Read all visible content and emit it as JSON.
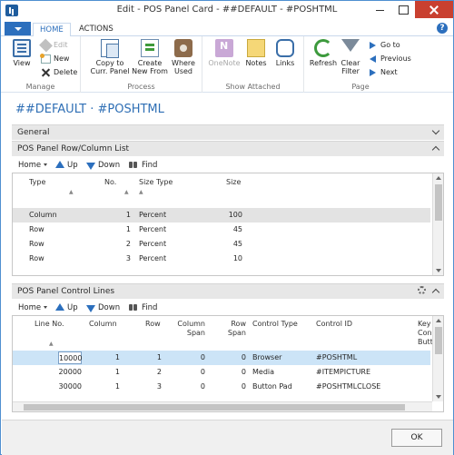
{
  "window": {
    "title": "Edit - POS Panel Card - ##DEFAULT - #POSHTML"
  },
  "ribbon_tabs": {
    "home": "HOME",
    "actions": "ACTIONS"
  },
  "ribbon": {
    "manage": {
      "label": "Manage",
      "view": "View",
      "edit": "Edit",
      "new": "New",
      "delete": "Delete"
    },
    "process": {
      "label": "Process",
      "copy": [
        "Copy to",
        "Curr. Panel"
      ],
      "create": [
        "Create",
        "New From"
      ],
      "where": [
        "Where",
        "Used"
      ]
    },
    "attached": {
      "label": "Show Attached",
      "onenote": "OneNote",
      "notes": "Notes",
      "links": "Links"
    },
    "page": {
      "label": "Page",
      "refresh": "Refresh",
      "clear_filter": [
        "Clear",
        "Filter"
      ],
      "goto": "Go to",
      "previous": "Previous",
      "next": "Next"
    }
  },
  "page_title": "##DEFAULT · #POSHTML",
  "general": {
    "label": "General"
  },
  "rowcol": {
    "label": "POS Panel Row/Column List",
    "toolbar": {
      "home": "Home",
      "up": "Up",
      "down": "Down",
      "find": "Find"
    },
    "columns": [
      "Type",
      "No.",
      "Size Type",
      "Size"
    ],
    "rows": [
      {
        "type": "Column",
        "no": "1",
        "size_type": "Percent",
        "size": "100"
      },
      {
        "type": "Row",
        "no": "1",
        "size_type": "Percent",
        "size": "45"
      },
      {
        "type": "Row",
        "no": "2",
        "size_type": "Percent",
        "size": "45"
      },
      {
        "type": "Row",
        "no": "3",
        "size_type": "Percent",
        "size": "10"
      }
    ]
  },
  "control": {
    "label": "POS Panel Control Lines",
    "toolbar": {
      "home": "Home",
      "up": "Up",
      "down": "Down",
      "find": "Find"
    },
    "columns": {
      "line_no": "Line No.",
      "column": "Column",
      "row": "Row",
      "column_span": [
        "Column",
        "Span"
      ],
      "row_span": [
        "Row",
        "Span"
      ],
      "control_type": "Control Type",
      "control_id": "Control ID",
      "extra": [
        "Key",
        "Con",
        "Butt"
      ]
    },
    "rows": [
      {
        "line_no": "10000",
        "column": "1",
        "row": "1",
        "column_span": "0",
        "row_span": "0",
        "control_type": "Browser",
        "control_id": "#POSHTML"
      },
      {
        "line_no": "20000",
        "column": "1",
        "row": "2",
        "column_span": "0",
        "row_span": "0",
        "control_type": "Media",
        "control_id": "#ITEMPICTURE"
      },
      {
        "line_no": "30000",
        "column": "1",
        "row": "3",
        "column_span": "0",
        "row_span": "0",
        "control_type": "Button Pad",
        "control_id": "#POSHTMLCLOSE"
      }
    ]
  },
  "footer": {
    "ok": "OK"
  },
  "colors": {
    "accent": "#2c6fbd",
    "title_blue": "#2f6fb5",
    "close_red": "#c94030",
    "selected_row": "#cce4f7"
  }
}
